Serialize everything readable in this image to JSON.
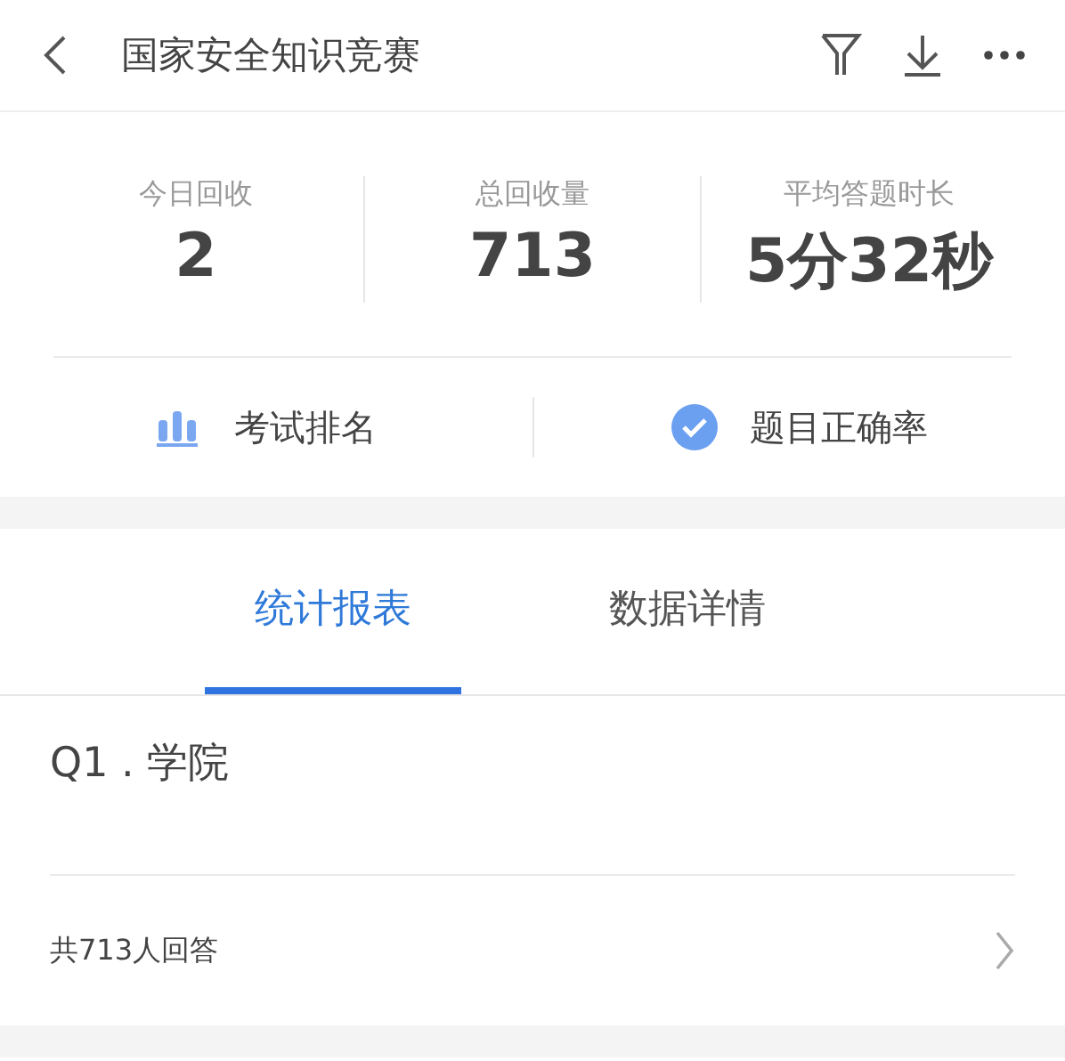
{
  "header": {
    "title": "国家安全知识竞赛"
  },
  "stats": [
    {
      "label": "今日回收",
      "value": "2"
    },
    {
      "label": "总回收量",
      "value": "713"
    },
    {
      "label": "平均答题时长",
      "value": "5分32秒"
    }
  ],
  "actions": [
    {
      "kind": "ranking",
      "label": "考试排名"
    },
    {
      "kind": "accuracy",
      "label": "题目正确率"
    }
  ],
  "tabs": [
    {
      "label": "统计报表",
      "selected": true
    },
    {
      "label": "数据详情",
      "selected": false
    }
  ],
  "question": {
    "title": "Q1 . 学院",
    "answers": "共713人回答"
  }
}
